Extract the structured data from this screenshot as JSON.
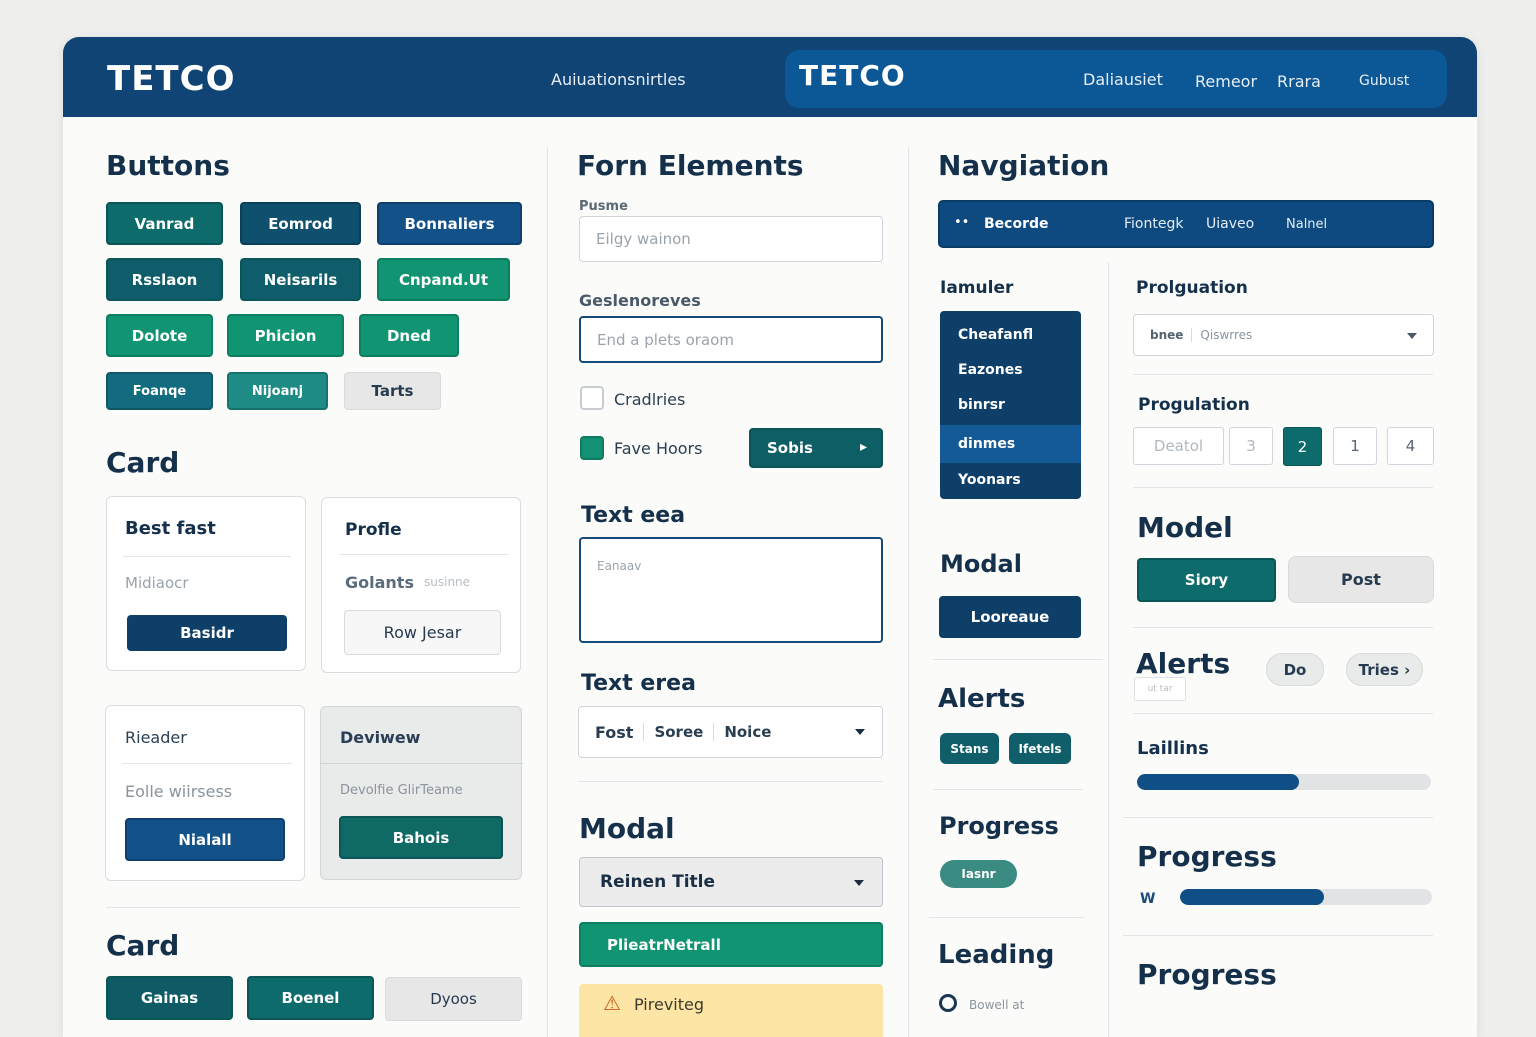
{
  "header": {
    "logo": "TETCO",
    "link_left": "Auiuationsnirtles",
    "logo_right": "TETCO",
    "links": [
      "Daliausiet",
      "Remeor",
      "Rrara",
      "Gubust"
    ]
  },
  "buttons": {
    "title": "Buttons",
    "rows": [
      [
        "Vanrad",
        "Eomrod",
        "Bonnaliers"
      ],
      [
        "Rsslaon",
        "Neisarils",
        "Cnpand.Ut"
      ],
      [
        "Dolote",
        "Phicion",
        "Dned"
      ],
      [
        "Foanqe",
        "Nijoanj",
        "Tarts"
      ]
    ]
  },
  "card": {
    "title": "Card",
    "cards": [
      {
        "title": "Best fast",
        "text": "Midiaocr",
        "button": "Basidr"
      },
      {
        "title": "Profle",
        "text": "Golants",
        "text2": "susinne",
        "button": "Row Jesar"
      },
      {
        "title": "Rieader",
        "text": "Eolle wiirsess",
        "button": "Nialall"
      },
      {
        "title": "Deviwew",
        "text": "Devolfie GlirTeame",
        "button": "Bahois"
      }
    ]
  },
  "card2": {
    "title": "Card",
    "buttons": [
      "Gainas",
      "Boenel",
      "Dyoos"
    ]
  },
  "forms": {
    "title": "Forn Elements",
    "field1_label": "Pusme",
    "field1_placeholder": "Eilgy wainon",
    "field2_label": "Geslenoreves",
    "field2_placeholder": "End a plets oraom",
    "check1": "Cradlries",
    "check2": "Fave Hoors",
    "submit": "Sobis",
    "textarea_title": "Text eea",
    "textarea_placeholder": "Eanaav",
    "select_title": "Text erea",
    "select_options": [
      "Fost",
      "Soree",
      "Noice"
    ]
  },
  "modal_form": {
    "title": "Modal",
    "select_value": "Reinen Title",
    "primary": "PlieatrNetrall",
    "warning": "Pireviteg"
  },
  "navigation": {
    "title": "Navgiation",
    "bar_items": [
      "Becorde",
      "Fiontegk",
      "Uiaveo",
      "Nalnel"
    ],
    "sidemenu_title": "Iamuler",
    "sidemenu_items": [
      "Cheafanfl",
      "Eazones",
      "binrsr",
      "dinmes",
      "Yoonars"
    ],
    "modal_title": "Modal",
    "modal_button": "Looreaue",
    "alerts_title": "Alerts",
    "alert_chips": [
      "Stans",
      "Ifetels"
    ],
    "progress_title": "Progress",
    "progress_chip": "Iasnr",
    "leading_title": "Leading",
    "leading_text": "Bowell at"
  },
  "right": {
    "prolg_title": "Prolguation",
    "select_text": "bnee",
    "select_text2": "Qiswrres",
    "pagination_title": "Progulation",
    "pages": [
      "Deatol",
      "3",
      "2",
      "1",
      "4"
    ],
    "active_page": "2",
    "model_title": "Model",
    "model_buttons": [
      "Siory",
      "Post"
    ],
    "alerts_title": "Alerts",
    "alerts_sub": "ut tar",
    "alerts_buttons": [
      "Do",
      "Tries ›"
    ],
    "loading_title": "Laillins",
    "loading_value": 0.55,
    "progress_title": "Progress",
    "progress_icon_label": "W",
    "progress_value": 0.57,
    "progress_title2": "Progress"
  },
  "colors": {
    "header": "#0f4474",
    "teal": "#0e6b6b",
    "navy": "#135189",
    "green": "#119472",
    "warning": "#fde6a5"
  }
}
